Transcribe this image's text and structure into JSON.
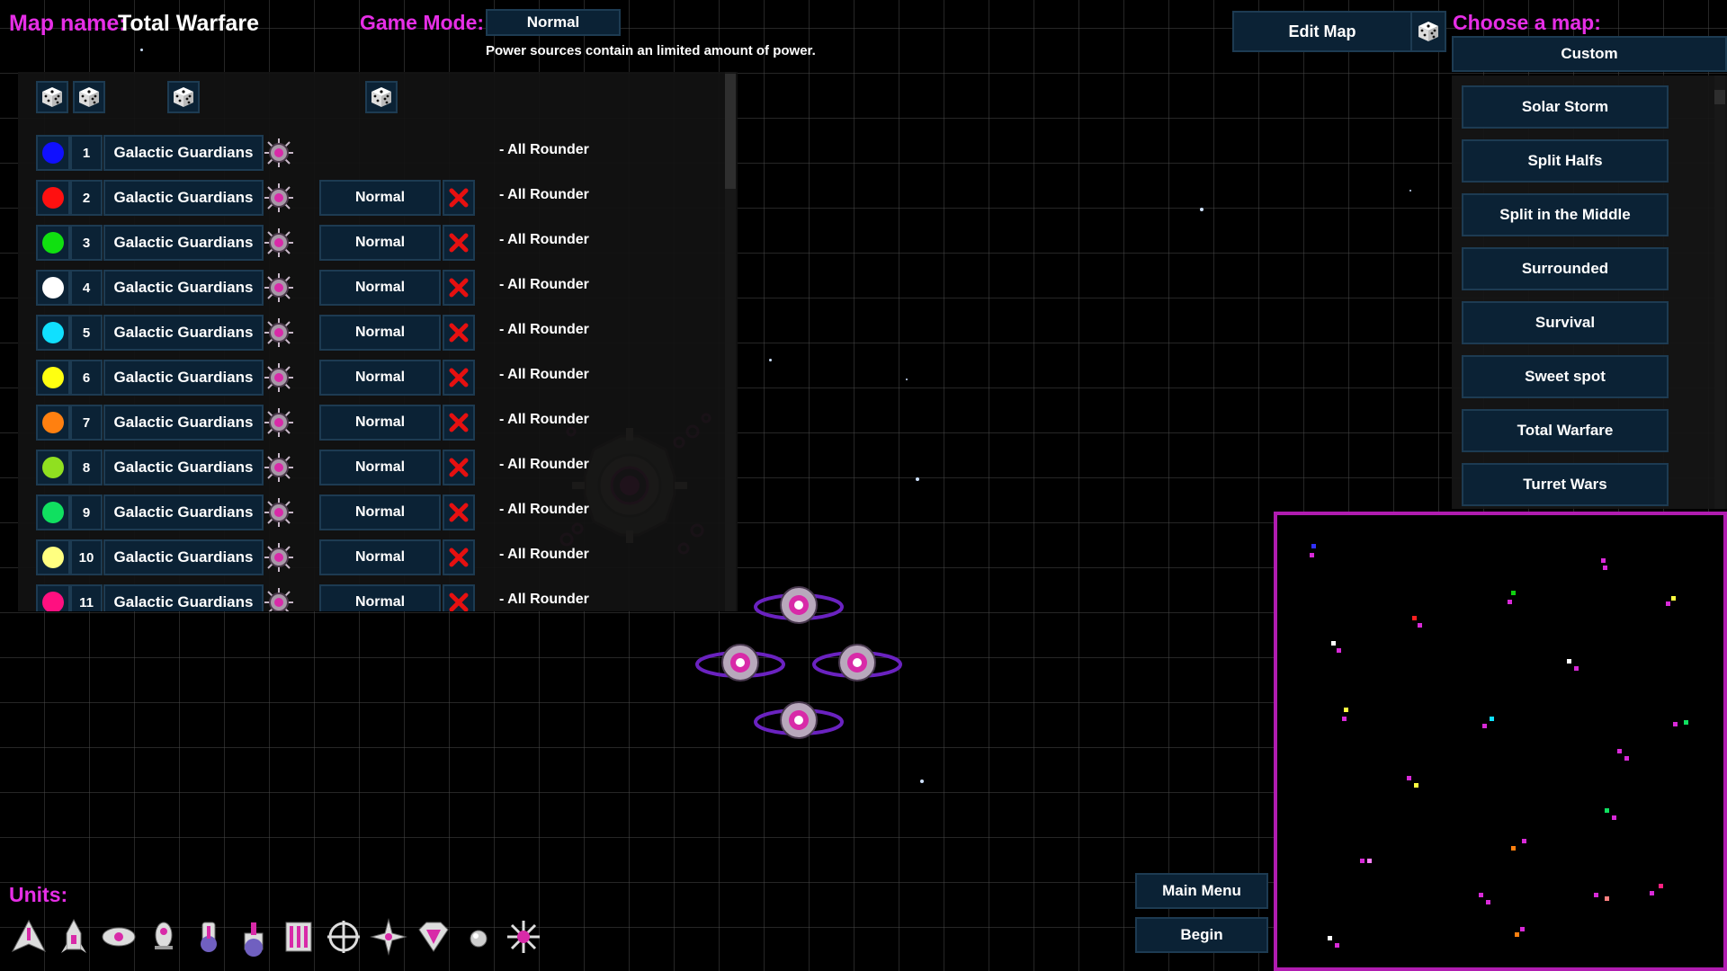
{
  "header": {
    "map_name_label": "Map name:",
    "map_name_value": "Total Warfare",
    "game_mode_label": "Game Mode:",
    "game_mode_value": "Normal",
    "game_mode_desc": "Power sources contain an limited amount of power."
  },
  "edit_map_label": "Edit Map",
  "choose_map": {
    "label": "Choose a map:",
    "selected": "Custom",
    "maps": [
      "Solar Storm",
      "Split Halfs",
      "Split in the Middle",
      "Surrounded",
      "Survival",
      "Sweet spot",
      "Total Warfare",
      "Turret Wars"
    ]
  },
  "players": [
    {
      "num": "1",
      "faction": "Galactic Guardians",
      "difficulty": "",
      "desc": "- All Rounder",
      "color": "#1010ff"
    },
    {
      "num": "2",
      "faction": "Galactic Guardians",
      "difficulty": "Normal",
      "desc": "- All Rounder",
      "color": "#ff1010"
    },
    {
      "num": "3",
      "faction": "Galactic Guardians",
      "difficulty": "Normal",
      "desc": "- All Rounder",
      "color": "#10e010"
    },
    {
      "num": "4",
      "faction": "Galactic Guardians",
      "difficulty": "Normal",
      "desc": "- All Rounder",
      "color": "#ffffff"
    },
    {
      "num": "5",
      "faction": "Galactic Guardians",
      "difficulty": "Normal",
      "desc": "- All Rounder",
      "color": "#10e0ff"
    },
    {
      "num": "6",
      "faction": "Galactic Guardians",
      "difficulty": "Normal",
      "desc": "- All Rounder",
      "color": "#ffff10"
    },
    {
      "num": "7",
      "faction": "Galactic Guardians",
      "difficulty": "Normal",
      "desc": "- All Rounder",
      "color": "#ff8010"
    },
    {
      "num": "8",
      "faction": "Galactic Guardians",
      "difficulty": "Normal",
      "desc": "- All Rounder",
      "color": "#90e020"
    },
    {
      "num": "9",
      "faction": "Galactic Guardians",
      "difficulty": "Normal",
      "desc": "- All Rounder",
      "color": "#10e060"
    },
    {
      "num": "10",
      "faction": "Galactic Guardians",
      "difficulty": "Normal",
      "desc": "- All Rounder",
      "color": "#ffff80"
    },
    {
      "num": "11",
      "faction": "Galactic Guardians",
      "difficulty": "Normal",
      "desc": "- All Rounder",
      "color": "#ff1080"
    }
  ],
  "units_label": "Units:",
  "units": [
    "fighter-unit-icon",
    "rocket-unit-icon",
    "bomber-unit-icon",
    "pod-unit-icon",
    "cannon-unit-icon",
    "tank-unit-icon",
    "carrier-unit-icon",
    "crosshair-unit-icon",
    "drone-unit-icon",
    "diamond-unit-icon",
    "sphere-unit-icon",
    "star-unit-icon"
  ],
  "buttons": {
    "main_menu": "Main Menu",
    "begin": "Begin"
  },
  "colors": {
    "accent": "#e62ee6",
    "button_bg": "#0b2235",
    "minimap_border": "#b01cb0"
  }
}
